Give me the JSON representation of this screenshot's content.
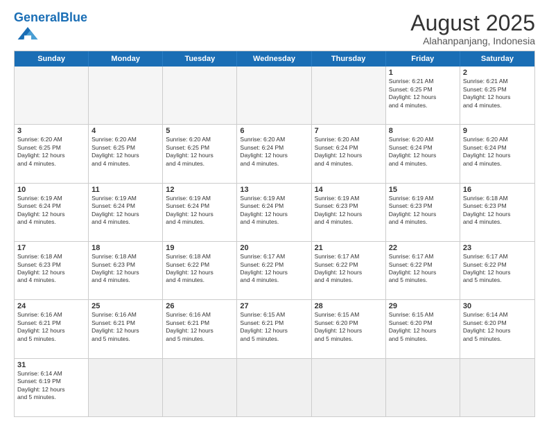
{
  "header": {
    "logo_general": "General",
    "logo_blue": "Blue",
    "month_year": "August 2025",
    "location": "Alahanpanjang, Indonesia"
  },
  "weekdays": [
    "Sunday",
    "Monday",
    "Tuesday",
    "Wednesday",
    "Thursday",
    "Friday",
    "Saturday"
  ],
  "rows": [
    [
      {
        "day": "",
        "info": ""
      },
      {
        "day": "",
        "info": ""
      },
      {
        "day": "",
        "info": ""
      },
      {
        "day": "",
        "info": ""
      },
      {
        "day": "",
        "info": ""
      },
      {
        "day": "1",
        "info": "Sunrise: 6:21 AM\nSunset: 6:25 PM\nDaylight: 12 hours\nand 4 minutes."
      },
      {
        "day": "2",
        "info": "Sunrise: 6:21 AM\nSunset: 6:25 PM\nDaylight: 12 hours\nand 4 minutes."
      }
    ],
    [
      {
        "day": "3",
        "info": "Sunrise: 6:20 AM\nSunset: 6:25 PM\nDaylight: 12 hours\nand 4 minutes."
      },
      {
        "day": "4",
        "info": "Sunrise: 6:20 AM\nSunset: 6:25 PM\nDaylight: 12 hours\nand 4 minutes."
      },
      {
        "day": "5",
        "info": "Sunrise: 6:20 AM\nSunset: 6:25 PM\nDaylight: 12 hours\nand 4 minutes."
      },
      {
        "day": "6",
        "info": "Sunrise: 6:20 AM\nSunset: 6:24 PM\nDaylight: 12 hours\nand 4 minutes."
      },
      {
        "day": "7",
        "info": "Sunrise: 6:20 AM\nSunset: 6:24 PM\nDaylight: 12 hours\nand 4 minutes."
      },
      {
        "day": "8",
        "info": "Sunrise: 6:20 AM\nSunset: 6:24 PM\nDaylight: 12 hours\nand 4 minutes."
      },
      {
        "day": "9",
        "info": "Sunrise: 6:20 AM\nSunset: 6:24 PM\nDaylight: 12 hours\nand 4 minutes."
      }
    ],
    [
      {
        "day": "10",
        "info": "Sunrise: 6:19 AM\nSunset: 6:24 PM\nDaylight: 12 hours\nand 4 minutes."
      },
      {
        "day": "11",
        "info": "Sunrise: 6:19 AM\nSunset: 6:24 PM\nDaylight: 12 hours\nand 4 minutes."
      },
      {
        "day": "12",
        "info": "Sunrise: 6:19 AM\nSunset: 6:24 PM\nDaylight: 12 hours\nand 4 minutes."
      },
      {
        "day": "13",
        "info": "Sunrise: 6:19 AM\nSunset: 6:24 PM\nDaylight: 12 hours\nand 4 minutes."
      },
      {
        "day": "14",
        "info": "Sunrise: 6:19 AM\nSunset: 6:23 PM\nDaylight: 12 hours\nand 4 minutes."
      },
      {
        "day": "15",
        "info": "Sunrise: 6:19 AM\nSunset: 6:23 PM\nDaylight: 12 hours\nand 4 minutes."
      },
      {
        "day": "16",
        "info": "Sunrise: 6:18 AM\nSunset: 6:23 PM\nDaylight: 12 hours\nand 4 minutes."
      }
    ],
    [
      {
        "day": "17",
        "info": "Sunrise: 6:18 AM\nSunset: 6:23 PM\nDaylight: 12 hours\nand 4 minutes."
      },
      {
        "day": "18",
        "info": "Sunrise: 6:18 AM\nSunset: 6:23 PM\nDaylight: 12 hours\nand 4 minutes."
      },
      {
        "day": "19",
        "info": "Sunrise: 6:18 AM\nSunset: 6:22 PM\nDaylight: 12 hours\nand 4 minutes."
      },
      {
        "day": "20",
        "info": "Sunrise: 6:17 AM\nSunset: 6:22 PM\nDaylight: 12 hours\nand 4 minutes."
      },
      {
        "day": "21",
        "info": "Sunrise: 6:17 AM\nSunset: 6:22 PM\nDaylight: 12 hours\nand 4 minutes."
      },
      {
        "day": "22",
        "info": "Sunrise: 6:17 AM\nSunset: 6:22 PM\nDaylight: 12 hours\nand 5 minutes."
      },
      {
        "day": "23",
        "info": "Sunrise: 6:17 AM\nSunset: 6:22 PM\nDaylight: 12 hours\nand 5 minutes."
      }
    ],
    [
      {
        "day": "24",
        "info": "Sunrise: 6:16 AM\nSunset: 6:21 PM\nDaylight: 12 hours\nand 5 minutes."
      },
      {
        "day": "25",
        "info": "Sunrise: 6:16 AM\nSunset: 6:21 PM\nDaylight: 12 hours\nand 5 minutes."
      },
      {
        "day": "26",
        "info": "Sunrise: 6:16 AM\nSunset: 6:21 PM\nDaylight: 12 hours\nand 5 minutes."
      },
      {
        "day": "27",
        "info": "Sunrise: 6:15 AM\nSunset: 6:21 PM\nDaylight: 12 hours\nand 5 minutes."
      },
      {
        "day": "28",
        "info": "Sunrise: 6:15 AM\nSunset: 6:20 PM\nDaylight: 12 hours\nand 5 minutes."
      },
      {
        "day": "29",
        "info": "Sunrise: 6:15 AM\nSunset: 6:20 PM\nDaylight: 12 hours\nand 5 minutes."
      },
      {
        "day": "30",
        "info": "Sunrise: 6:14 AM\nSunset: 6:20 PM\nDaylight: 12 hours\nand 5 minutes."
      }
    ],
    [
      {
        "day": "31",
        "info": "Sunrise: 6:14 AM\nSunset: 6:19 PM\nDaylight: 12 hours\nand 5 minutes."
      },
      {
        "day": "",
        "info": ""
      },
      {
        "day": "",
        "info": ""
      },
      {
        "day": "",
        "info": ""
      },
      {
        "day": "",
        "info": ""
      },
      {
        "day": "",
        "info": ""
      },
      {
        "day": "",
        "info": ""
      }
    ]
  ]
}
